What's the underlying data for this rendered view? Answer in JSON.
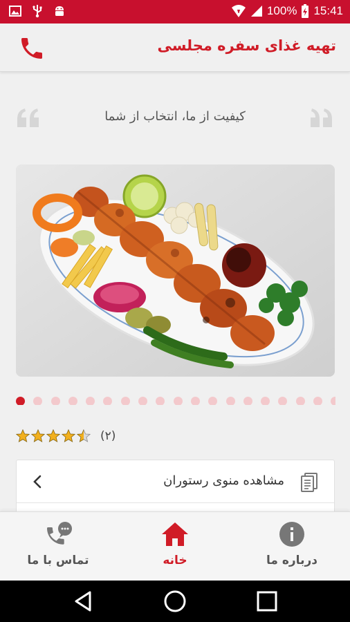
{
  "status_bar": {
    "battery": "100%",
    "time": "15:41",
    "left_icons": [
      "image-icon",
      "usb-icon",
      "android-icon"
    ],
    "right_icons": [
      "wifi-icon",
      "signal-icon",
      "battery-charging-icon"
    ]
  },
  "header": {
    "title": "تهیه غذای سفره مجلسی",
    "action_icon": "phone-icon"
  },
  "tagline": {
    "text": "کیفیت از ما، انتخاب از شما"
  },
  "carousel": {
    "image": "kebab-platter",
    "total_slides": 19,
    "active_index": 0
  },
  "rating": {
    "value": 4.5,
    "max": 5,
    "count_text": "(۲)"
  },
  "menu": {
    "items": [
      {
        "label": "مشاهده منوی رستوران",
        "icon": "menu-book-icon",
        "arrow": "chevron-left-icon"
      }
    ]
  },
  "bottom_nav": {
    "items": [
      {
        "label": "تماس با ما",
        "icon": "phone-chat-icon",
        "active": false
      },
      {
        "label": "خانه",
        "icon": "home-icon",
        "active": true
      },
      {
        "label": "درباره ما",
        "icon": "info-icon",
        "active": false
      }
    ]
  },
  "system_nav": [
    "back-icon",
    "home-circle-icon",
    "recents-icon"
  ],
  "colors": {
    "brand_red": "#d01c27",
    "status_bar": "#c8102e",
    "background": "#f0f0f0",
    "dot_inactive": "#f3c9cc",
    "star": "#f2b01e"
  }
}
